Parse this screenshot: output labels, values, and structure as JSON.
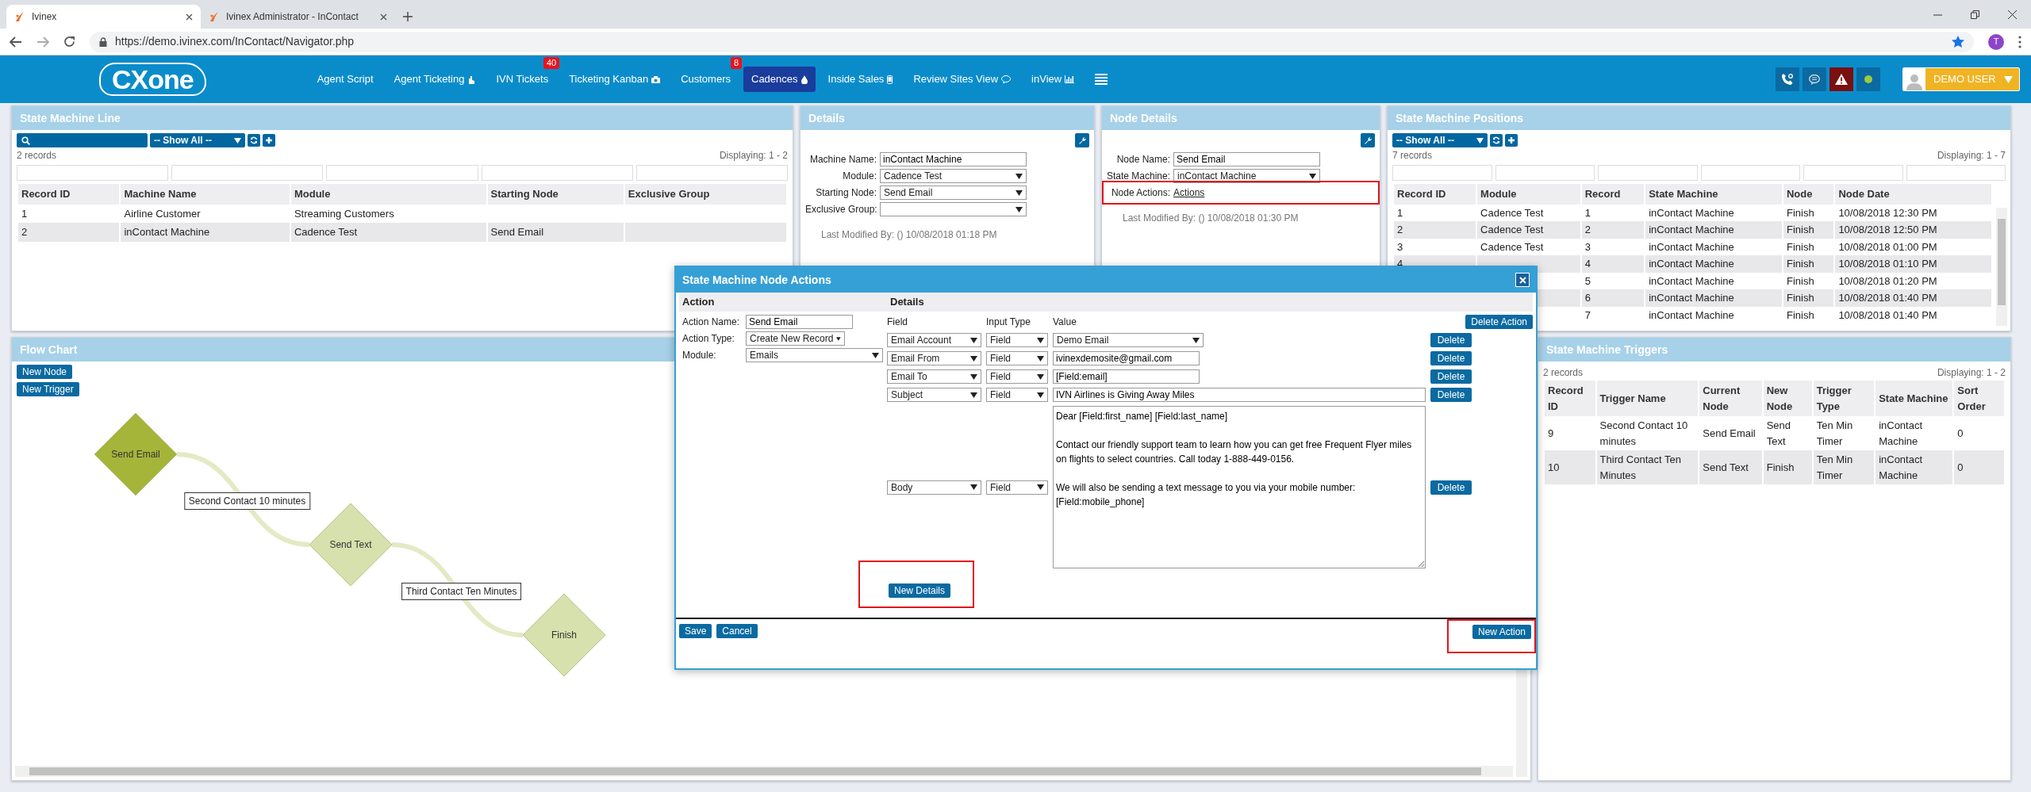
{
  "browser": {
    "tabs": [
      {
        "title": "Ivinex",
        "selected": true
      },
      {
        "title": "Ivinex Administrator - InContact",
        "selected": false
      }
    ],
    "url": "https://demo.ivinex.com/InContact/Navigator.php",
    "profile_initial": "T"
  },
  "navbar": {
    "logo": "CXone",
    "items": [
      {
        "label": "Agent Script",
        "selected": false,
        "has_icon": false
      },
      {
        "label": "Agent Ticketing",
        "selected": false,
        "has_icon": true
      },
      {
        "label": "IVN Tickets",
        "selected": false,
        "has_icon": false,
        "badge": "40"
      },
      {
        "label": "Ticketing Kanban",
        "selected": false,
        "has_icon": true
      },
      {
        "label": "Customers",
        "selected": false,
        "has_icon": false,
        "badge": "8"
      },
      {
        "label": "Cadences",
        "selected": true,
        "has_icon": true
      },
      {
        "label": "Inside Sales",
        "selected": false,
        "has_icon": true
      },
      {
        "label": "Review Sites View",
        "selected": false,
        "has_icon": true
      },
      {
        "label": "inView",
        "selected": false,
        "has_icon": true
      }
    ],
    "user": "DEMO USER"
  },
  "state_machine_line": {
    "title": "State Machine Line",
    "filter": "-- Show All --",
    "record_count": "2 records",
    "displaying": "Displaying: 1 - 2",
    "columns": [
      "Record ID",
      "Machine Name",
      "Module",
      "Starting Node",
      "Exclusive Group"
    ],
    "rows": [
      [
        "1",
        "Airline Customer",
        "Streaming Customers",
        null,
        null
      ],
      [
        "2",
        "inContact Machine",
        "Cadence Test",
        "Send Email",
        null
      ]
    ]
  },
  "details": {
    "title": "Details",
    "fields": [
      {
        "label": "Machine Name:",
        "kind": "input",
        "value": "inContact Machine"
      },
      {
        "label": "Module:",
        "kind": "select",
        "value": "Cadence Test"
      },
      {
        "label": "Starting Node:",
        "kind": "select",
        "value": "Send Email"
      },
      {
        "label": "Exclusive Group:",
        "kind": "select"
      }
    ],
    "last_modified": "Last Modified By: () 10/08/2018 01:18 PM"
  },
  "node_details": {
    "title": "Node Details",
    "fields": [
      {
        "label": "Node Name:",
        "kind": "input",
        "value": "Send Email"
      },
      {
        "label": "State Machine:",
        "kind": "select",
        "value": "inContact Machine"
      },
      {
        "label": "Node Actions:",
        "kind": "link",
        "value": "Actions",
        "highlighted": true
      }
    ],
    "last_modified": "Last Modified By: () 10/08/2018 01:30 PM"
  },
  "positions": {
    "title": "State Machine Positions",
    "filter": "-- Show All --",
    "record_count": "7 records",
    "displaying": "Displaying: 1 - 7",
    "columns": [
      "Record ID",
      "Module",
      "Record",
      "State Machine",
      "Node",
      "Node Date"
    ],
    "rows": [
      [
        "1",
        "Cadence Test",
        "1",
        "inContact Machine",
        "Finish",
        "10/08/2018 12:30 PM"
      ],
      [
        "2",
        "Cadence Test",
        "2",
        "inContact Machine",
        "Finish",
        "10/08/2018 12:50 PM"
      ],
      [
        "3",
        "Cadence Test",
        "3",
        "inContact Machine",
        "Finish",
        "10/08/2018 01:00 PM"
      ],
      [
        "4",
        null,
        "4",
        "inContact Machine",
        "Finish",
        "10/08/2018 01:10 PM"
      ],
      [
        null,
        null,
        "5",
        "inContact Machine",
        "Finish",
        "10/08/2018 01:20 PM"
      ],
      [
        null,
        null,
        "6",
        "inContact Machine",
        "Finish",
        "10/08/2018 01:40 PM"
      ],
      [
        null,
        null,
        "7",
        "inContact Machine",
        "Finish",
        "10/08/2018 01:40 PM"
      ]
    ]
  },
  "flow_chart": {
    "title": "Flow Chart",
    "buttons": [
      "New Node",
      "New Trigger"
    ],
    "nodes": [
      {
        "label": "Send Email",
        "selected": true
      },
      {
        "label": "Send Text",
        "selected": false
      },
      {
        "label": "Finish",
        "selected": false
      }
    ],
    "transitions": [
      "Second Contact 10 minutes",
      "Third Contact Ten Minutes"
    ]
  },
  "triggers": {
    "title": "State Machine Triggers",
    "record_count": "2 records",
    "displaying": "Displaying: 1 - 2",
    "columns": [
      "Record ID",
      "Trigger Name",
      "Current Node",
      "New Node",
      "Trigger Type",
      "State Machine",
      "Sort Order"
    ],
    "rows": [
      [
        "9",
        "Second Contact 10 minutes",
        "Send Email",
        "Send Text",
        "Ten Min Timer",
        "inContact Machine",
        "0"
      ],
      [
        "10",
        "Third Contact Ten Minutes",
        "Send Text",
        "Finish",
        "Ten Min Timer",
        "inContact Machine",
        "0"
      ]
    ]
  },
  "modal": {
    "title": "State Machine Node Actions",
    "action_header": "Action",
    "details_header": "Details",
    "action_fields": [
      {
        "label": "Action Name:",
        "kind": "input",
        "value": "Send Email"
      },
      {
        "label": "Action Type:",
        "kind": "select",
        "value": "Create New Record"
      },
      {
        "label": "Module:",
        "kind": "select",
        "value": "Emails"
      }
    ],
    "detail_columns": [
      "Field",
      "Input Type",
      "Value"
    ],
    "delete_action": "Delete Action",
    "details": [
      {
        "field": "Email Account",
        "input_type": "Field",
        "kind": "select",
        "value": "Demo Email",
        "delete": "Delete"
      },
      {
        "field": "Email From",
        "input_type": "Field",
        "kind": "input",
        "value": "ivinexdemosite@gmail.com",
        "delete": "Delete"
      },
      {
        "field": "Email To",
        "input_type": "Field",
        "kind": "input",
        "value": "[Field:email]",
        "delete": "Delete"
      },
      {
        "field": "Subject",
        "input_type": "Field",
        "kind": "wide",
        "value": "IVN Airlines is Giving Away Miles",
        "delete": "Delete"
      },
      {
        "field": "Body",
        "input_type": "Field",
        "kind": "textarea",
        "value": "Dear [Field:first_name] [Field:last_name]\n\nContact our friendly support team to learn how you can get free Frequent Flyer miles on flights to select countries. Call today 1-888-449-0156.\n\nWe will also be sending a text message to you via your mobile number:\n[Field:mobile_phone]",
        "delete": "Delete"
      }
    ],
    "new_details": {
      "label": "New Details",
      "highlighted": true
    },
    "save": "Save",
    "cancel": "Cancel",
    "new_action": {
      "label": "New Action",
      "highlighted": true
    }
  }
}
